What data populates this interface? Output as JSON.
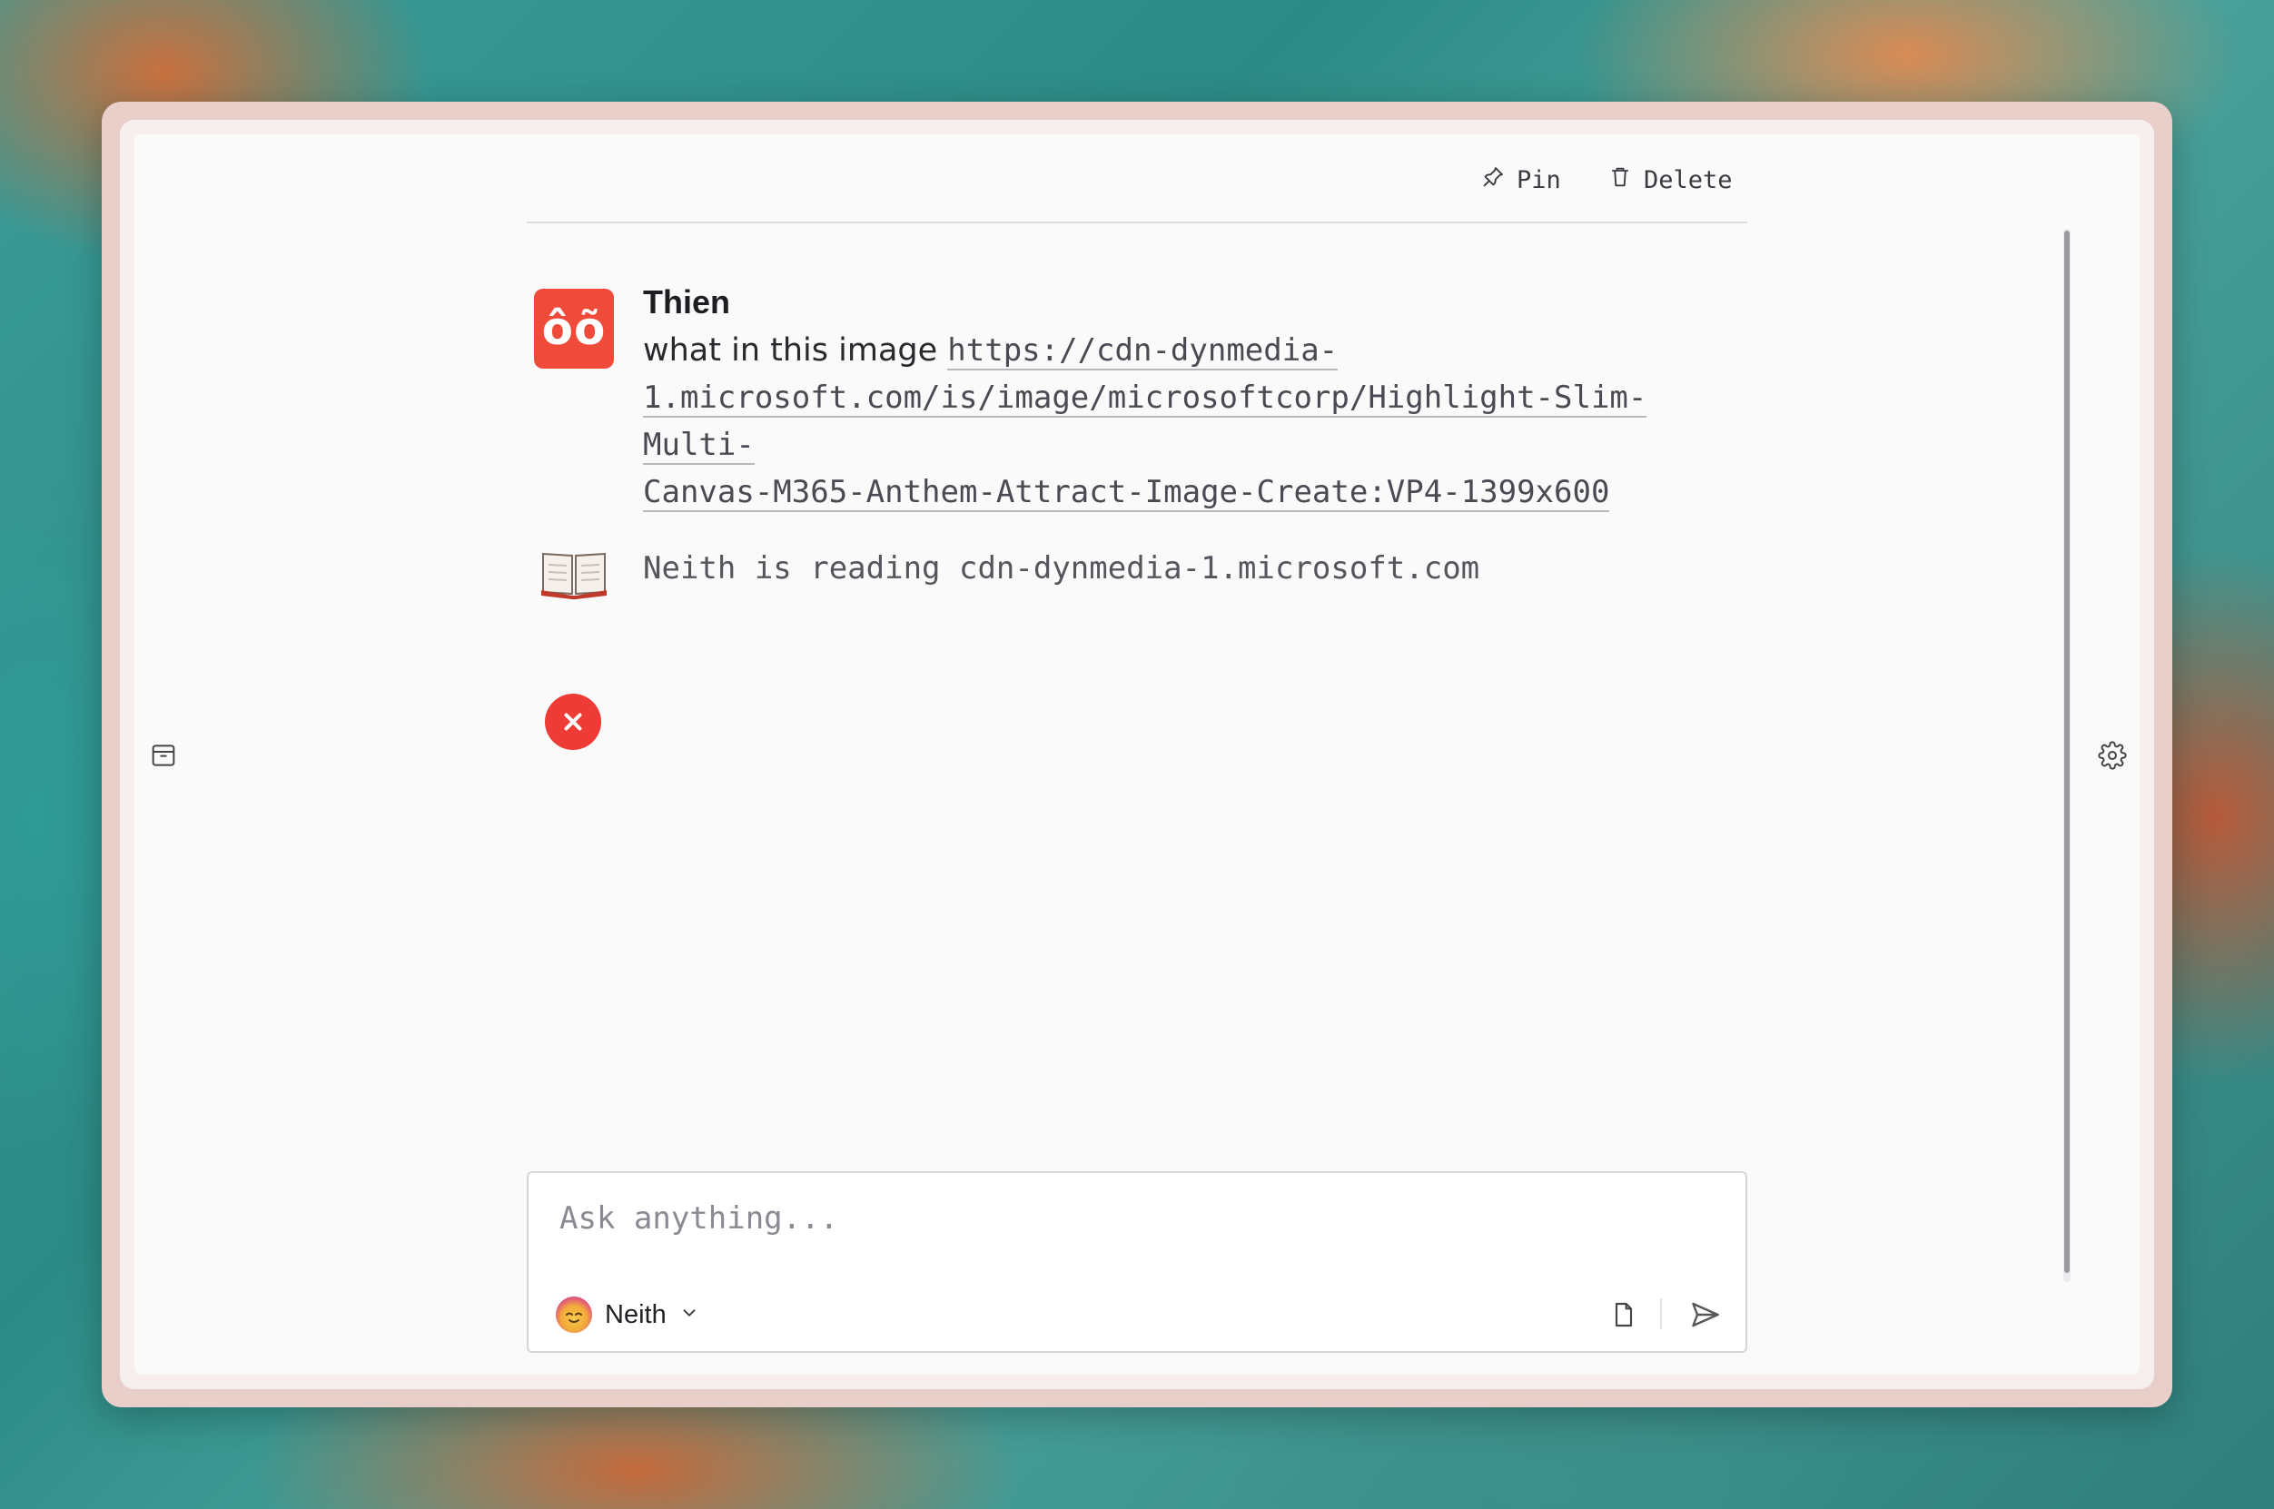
{
  "toolbar": {
    "pin_label": "Pin",
    "delete_label": "Delete",
    "pin_icon": "pin-icon",
    "delete_icon": "trash-icon"
  },
  "sidebar": {
    "archive_icon": "archive-icon",
    "settings_icon": "gear-icon"
  },
  "conversation": {
    "user_message": {
      "avatar_text": "ôõ",
      "author": "Thien",
      "text": "what in this image ",
      "link_line_1": "https://cdn-dynmedia-",
      "link_line_2": "1.microsoft.com/is/image/microsoftcorp/Highlight-Slim-Multi-",
      "link_line_3": "Canvas-M365-Anthem-Attract-Image-Create:VP4-1399x600"
    },
    "status_message": {
      "icon": "open-book-icon",
      "text": "Neith is reading cdn-dynmedia-1.microsoft.com"
    },
    "error_message": {
      "icon": "error-x-icon"
    }
  },
  "composer": {
    "placeholder": "Ask anything...",
    "model_name": "Neith",
    "model_icon": "sun-avatar",
    "attach_icon": "file-icon",
    "send_icon": "send-icon"
  },
  "colors": {
    "accent_red": "#ef4a3a",
    "frame": "#e8cfca",
    "window_bg": "#fafafb"
  }
}
